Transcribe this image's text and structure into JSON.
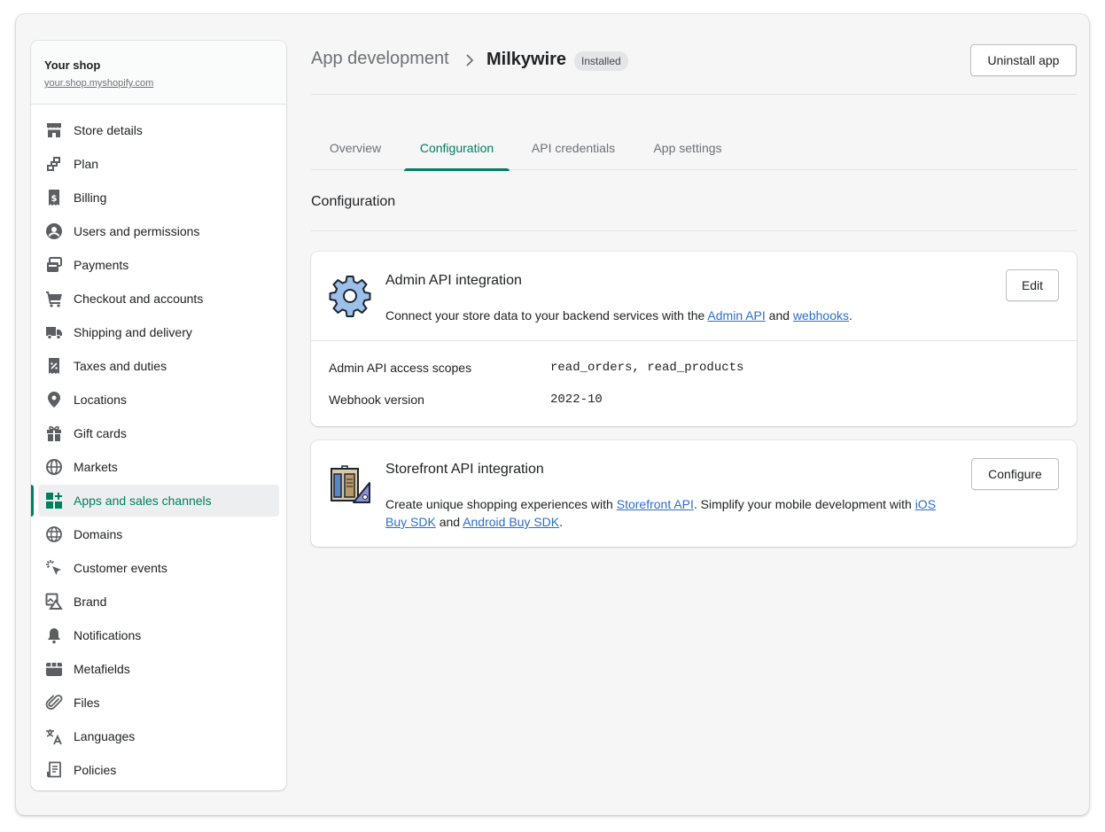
{
  "shop": {
    "name": "Your shop",
    "url": "your.shop.myshopify.com"
  },
  "sidebar": {
    "items": [
      {
        "label": "Store details",
        "icon": "store-icon"
      },
      {
        "label": "Plan",
        "icon": "plan-icon"
      },
      {
        "label": "Billing",
        "icon": "billing-icon"
      },
      {
        "label": "Users and permissions",
        "icon": "user-icon"
      },
      {
        "label": "Payments",
        "icon": "payments-icon"
      },
      {
        "label": "Checkout and accounts",
        "icon": "cart-icon"
      },
      {
        "label": "Shipping and delivery",
        "icon": "truck-icon"
      },
      {
        "label": "Taxes and duties",
        "icon": "tax-icon"
      },
      {
        "label": "Locations",
        "icon": "location-pin-icon"
      },
      {
        "label": "Gift cards",
        "icon": "gift-icon"
      },
      {
        "label": "Markets",
        "icon": "globe-icon"
      },
      {
        "label": "Apps and sales channels",
        "icon": "apps-icon",
        "active": true
      },
      {
        "label": "Domains",
        "icon": "domains-icon"
      },
      {
        "label": "Customer events",
        "icon": "cursor-click-icon"
      },
      {
        "label": "Brand",
        "icon": "brand-icon"
      },
      {
        "label": "Notifications",
        "icon": "bell-icon"
      },
      {
        "label": "Metafields",
        "icon": "metafields-icon"
      },
      {
        "label": "Files",
        "icon": "paperclip-icon"
      },
      {
        "label": "Languages",
        "icon": "translate-icon"
      },
      {
        "label": "Policies",
        "icon": "policies-icon"
      }
    ]
  },
  "header": {
    "breadcrumb": "App development",
    "app_title": "Milkywire",
    "status_badge": "Installed",
    "uninstall_label": "Uninstall app"
  },
  "tabs": [
    {
      "label": "Overview",
      "active": false
    },
    {
      "label": "Configuration",
      "active": true
    },
    {
      "label": "API credentials",
      "active": false
    },
    {
      "label": "App settings",
      "active": false
    }
  ],
  "section": {
    "title": "Configuration"
  },
  "admin_card": {
    "title": "Admin API integration",
    "desc_prefix": "Connect your store data to your backend services with the ",
    "link1": "Admin API",
    "desc_mid": " and ",
    "link2": "webhooks",
    "desc_suffix": ".",
    "edit_label": "Edit",
    "scopes_label": "Admin API access scopes",
    "scopes_value": "read_orders, read_products",
    "webhook_label": "Webhook version",
    "webhook_value": "2022-10",
    "icon": "gear-icon"
  },
  "storefront_card": {
    "title": "Storefront API integration",
    "desc_prefix": "Create unique shopping experiences with ",
    "link1": "Storefront API",
    "desc_mid": ". Simplify your mobile development with ",
    "link2": "iOS Buy SDK",
    "desc_and": " and ",
    "link3": "Android Buy SDK",
    "desc_suffix": ".",
    "configure_label": "Configure",
    "icon": "storefront-icon"
  },
  "colors": {
    "accent": "#008060",
    "accent_text": "#007f5f",
    "link": "#2c6ecb",
    "icon": "#5c5f62"
  }
}
